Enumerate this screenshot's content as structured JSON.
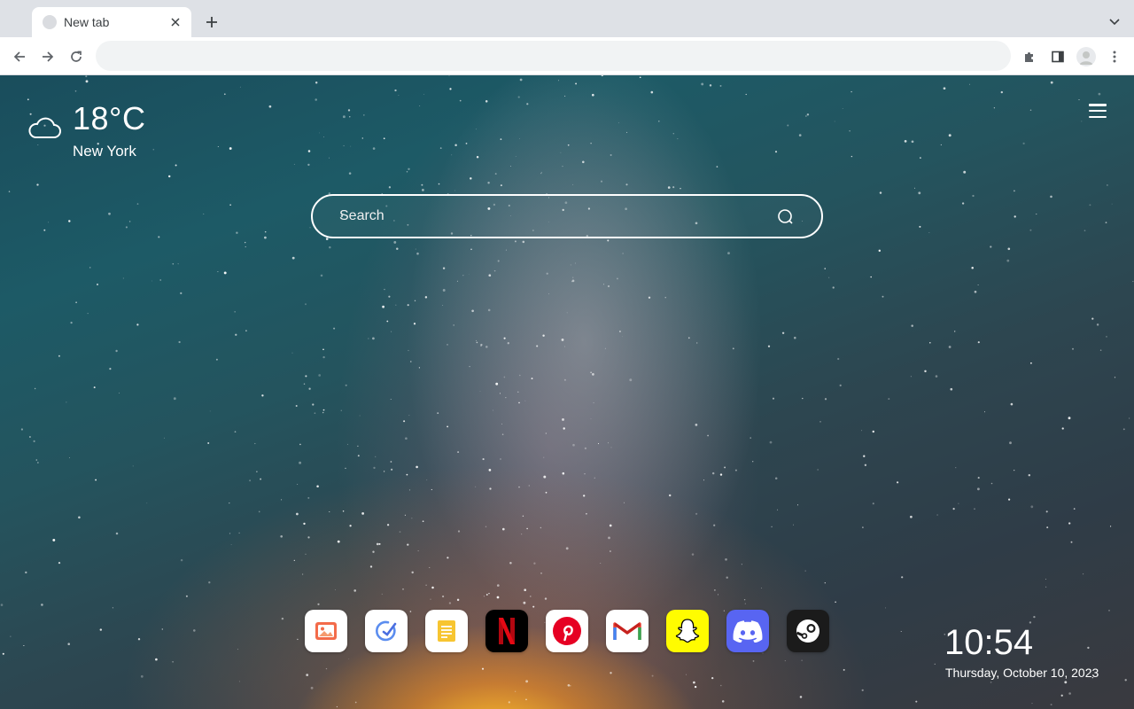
{
  "tab": {
    "title": "New tab"
  },
  "omnibox": {
    "value": "",
    "placeholder": ""
  },
  "weather": {
    "temperature": "18°C",
    "city": "New York",
    "icon": "cloud-icon"
  },
  "search": {
    "placeholder": "Search"
  },
  "dock": {
    "apps": [
      {
        "name": "photos",
        "icon": "photos-icon",
        "bg": "#ffffff"
      },
      {
        "name": "todo",
        "icon": "todo-icon",
        "bg": "#ffffff"
      },
      {
        "name": "notes",
        "icon": "notes-icon",
        "bg": "#ffffff"
      },
      {
        "name": "netflix",
        "icon": "netflix-icon",
        "bg": "#000000"
      },
      {
        "name": "pinterest",
        "icon": "pinterest-icon",
        "bg": "#ffffff"
      },
      {
        "name": "gmail",
        "icon": "gmail-icon",
        "bg": "#ffffff"
      },
      {
        "name": "snapchat",
        "icon": "snapchat-icon",
        "bg": "#fffc00"
      },
      {
        "name": "discord",
        "icon": "discord-icon",
        "bg": "#5865f2"
      },
      {
        "name": "steam",
        "icon": "steam-icon",
        "bg": "#1b1b1b"
      }
    ]
  },
  "clock": {
    "time": "10:54",
    "date": "Thursday, October 10, 2023"
  }
}
